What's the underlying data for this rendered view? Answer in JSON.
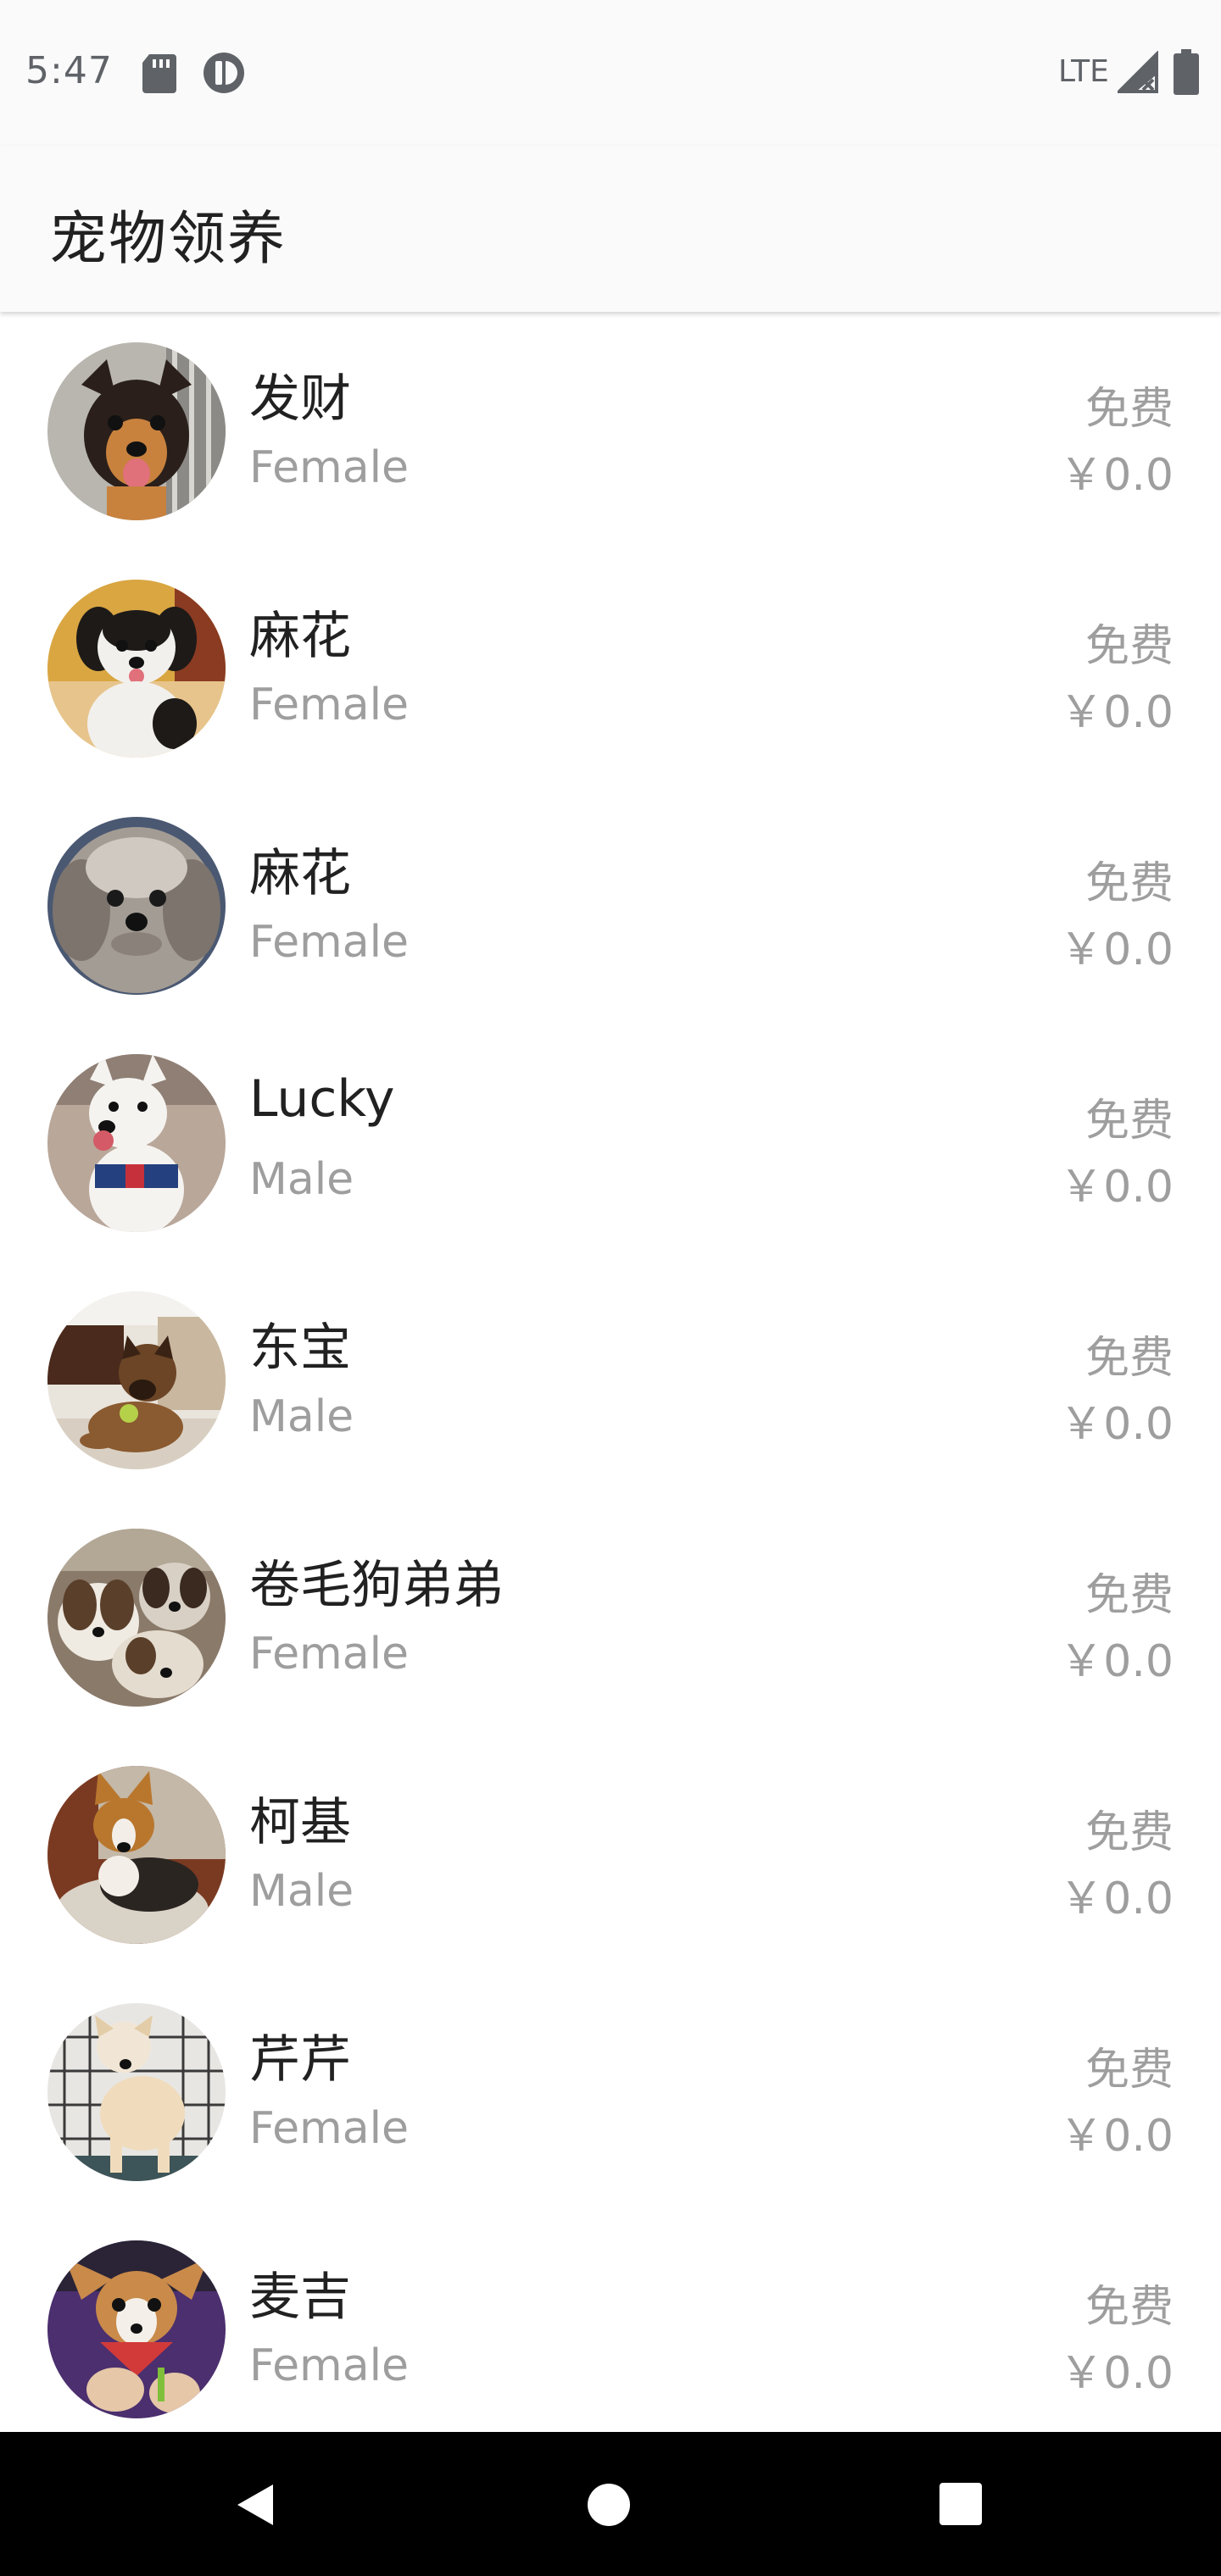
{
  "status_bar": {
    "time": "5:47",
    "network": "LTE",
    "icons": [
      "sd-card-icon",
      "pd-icon",
      "signal-icon",
      "battery-icon"
    ]
  },
  "app_bar": {
    "title": "宠物领养"
  },
  "pets": [
    {
      "name": "发财",
      "gender": "Female",
      "fee_label": "免费",
      "price": "￥0.0",
      "photo": "dog-photo"
    },
    {
      "name": "麻花",
      "gender": "Female",
      "fee_label": "免费",
      "price": "￥0.0",
      "photo": "dog-photo"
    },
    {
      "name": "麻花",
      "gender": "Female",
      "fee_label": "免费",
      "price": "￥0.0",
      "photo": "dog-photo"
    },
    {
      "name": "Lucky",
      "gender": "Male",
      "fee_label": "免费",
      "price": "￥0.0",
      "photo": "dog-photo"
    },
    {
      "name": "东宝",
      "gender": "Male",
      "fee_label": "免费",
      "price": "￥0.0",
      "photo": "dog-photo"
    },
    {
      "name": "卷毛狗弟弟",
      "gender": "Female",
      "fee_label": "免费",
      "price": "￥0.0",
      "photo": "dog-photo"
    },
    {
      "name": "柯基",
      "gender": "Male",
      "fee_label": "免费",
      "price": "￥0.0",
      "photo": "dog-photo"
    },
    {
      "name": "芹芹",
      "gender": "Female",
      "fee_label": "免费",
      "price": "￥0.0",
      "photo": "dog-photo"
    },
    {
      "name": "麦吉",
      "gender": "Female",
      "fee_label": "免费",
      "price": "￥0.0",
      "photo": "dog-photo"
    }
  ],
  "nav_bar": {
    "icons": [
      "back-icon",
      "home-icon",
      "recent-apps-icon"
    ]
  },
  "colors": {
    "status_bar_bg": "#fafafa",
    "app_bar_bg": "#fafafa",
    "primary_text": "#212121",
    "secondary_text": "#9e9e9e",
    "nav_bar_bg": "#000000"
  }
}
